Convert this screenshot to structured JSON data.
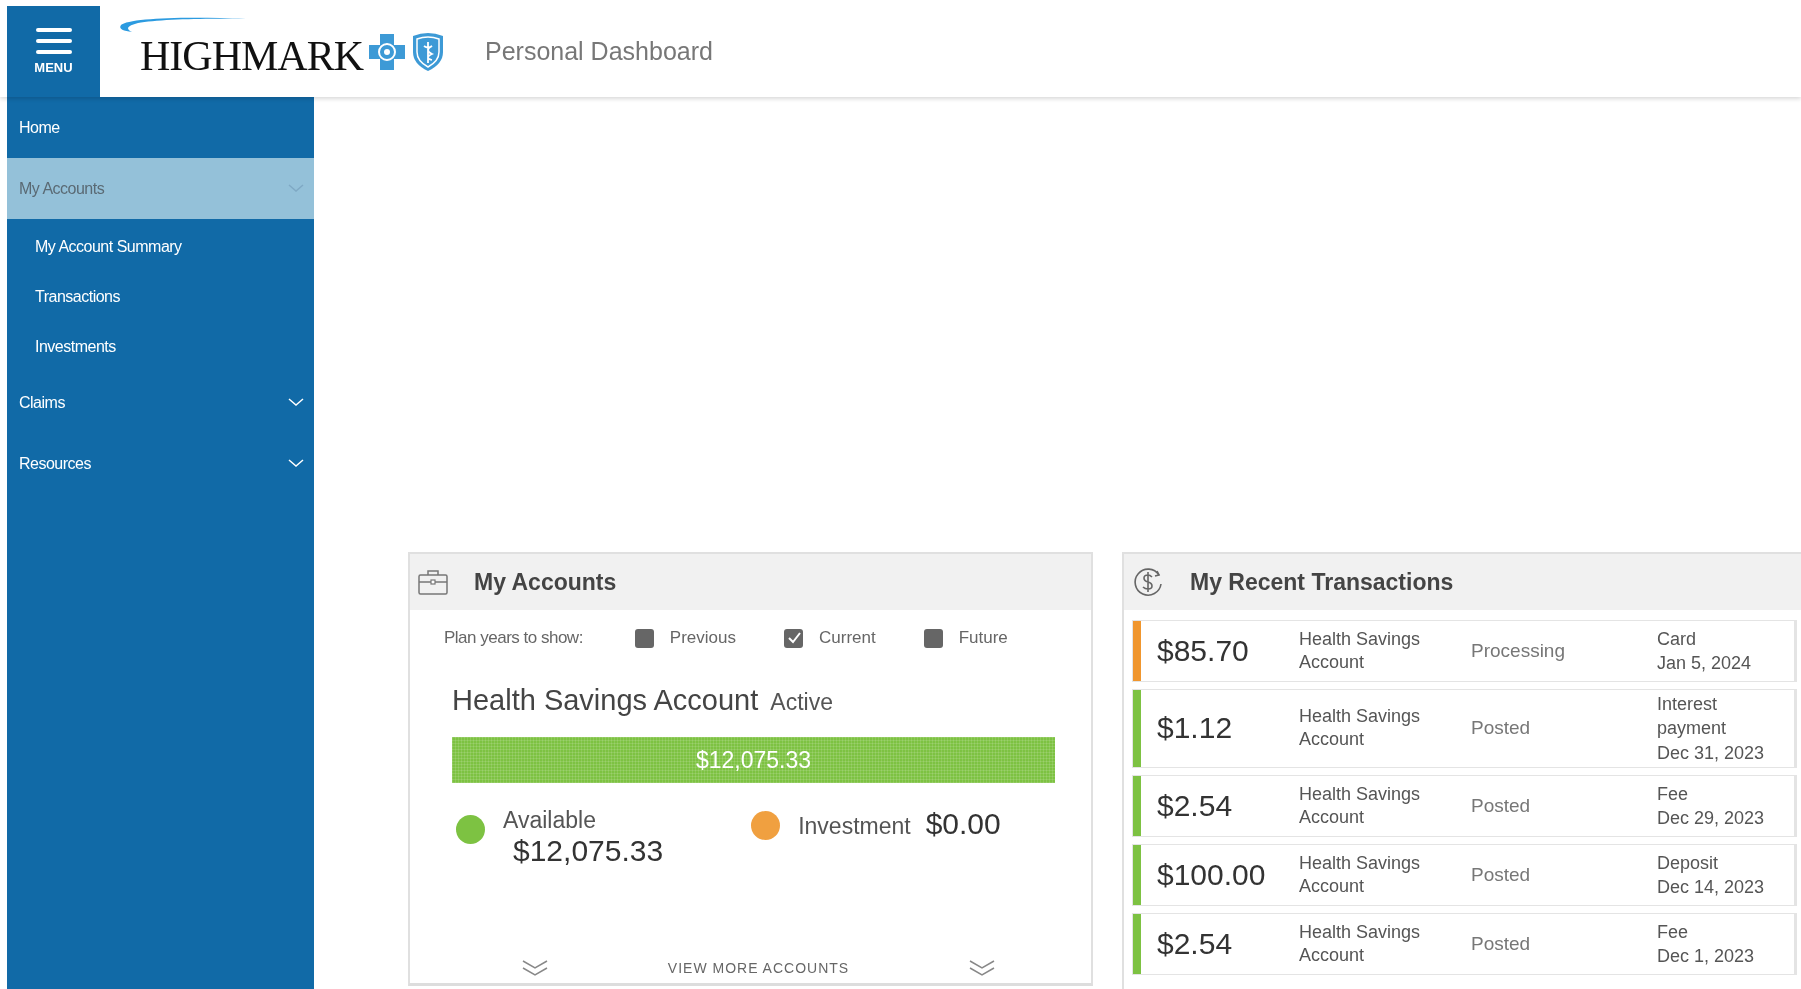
{
  "header": {
    "menu_label": "MENU",
    "logo_text": "HIGHMARK",
    "title": "Personal Dashboard"
  },
  "sidebar": {
    "items": [
      {
        "label": "Home",
        "kind": "link",
        "selected": false
      },
      {
        "label": "My Accounts",
        "kind": "group",
        "selected": true,
        "children": [
          {
            "label": "My Account Summary"
          },
          {
            "label": "Transactions"
          },
          {
            "label": "Investments"
          }
        ]
      },
      {
        "label": "Claims",
        "kind": "group",
        "selected": false
      },
      {
        "label": "Resources",
        "kind": "group",
        "selected": false
      }
    ]
  },
  "accounts": {
    "title": "My Accounts",
    "filter_label": "Plan years to show:",
    "plan_years": [
      {
        "label": "Previous",
        "checked": false
      },
      {
        "label": "Current",
        "checked": true
      },
      {
        "label": "Future",
        "checked": false
      }
    ],
    "account": {
      "name": "Health Savings Account",
      "status": "Active",
      "bar": {
        "label": "$12,075.33"
      },
      "legend": [
        {
          "kind": "stacked",
          "label": "Available",
          "amount": "$12,075.33",
          "color": "#7dc242"
        },
        {
          "kind": "inline",
          "label": "Investment",
          "amount": "$0.00",
          "color": "#f0a040"
        }
      ]
    },
    "view_more": "VIEW MORE ACCOUNTS"
  },
  "transactions": {
    "title": "My Recent Transactions",
    "rows": [
      {
        "amount": "$85.70",
        "account": "Health Savings Account",
        "status": "Processing",
        "type": "Card",
        "date": "Jan 5, 2024",
        "color": "#f0962e"
      },
      {
        "amount": "$1.12",
        "account": "Health Savings Account",
        "status": "Posted",
        "type": "Interest payment",
        "date": "Dec 31, 2023",
        "color": "#7dc242"
      },
      {
        "amount": "$2.54",
        "account": "Health Savings Account",
        "status": "Posted",
        "type": "Fee",
        "date": "Dec 29, 2023",
        "color": "#7dc242"
      },
      {
        "amount": "$100.00",
        "account": "Health Savings Account",
        "status": "Posted",
        "type": "Deposit",
        "date": "Dec 14, 2023",
        "color": "#7dc242"
      },
      {
        "amount": "$2.54",
        "account": "Health Savings Account",
        "status": "Posted",
        "type": "Fee",
        "date": "Dec 1, 2023",
        "color": "#7dc242"
      }
    ]
  }
}
